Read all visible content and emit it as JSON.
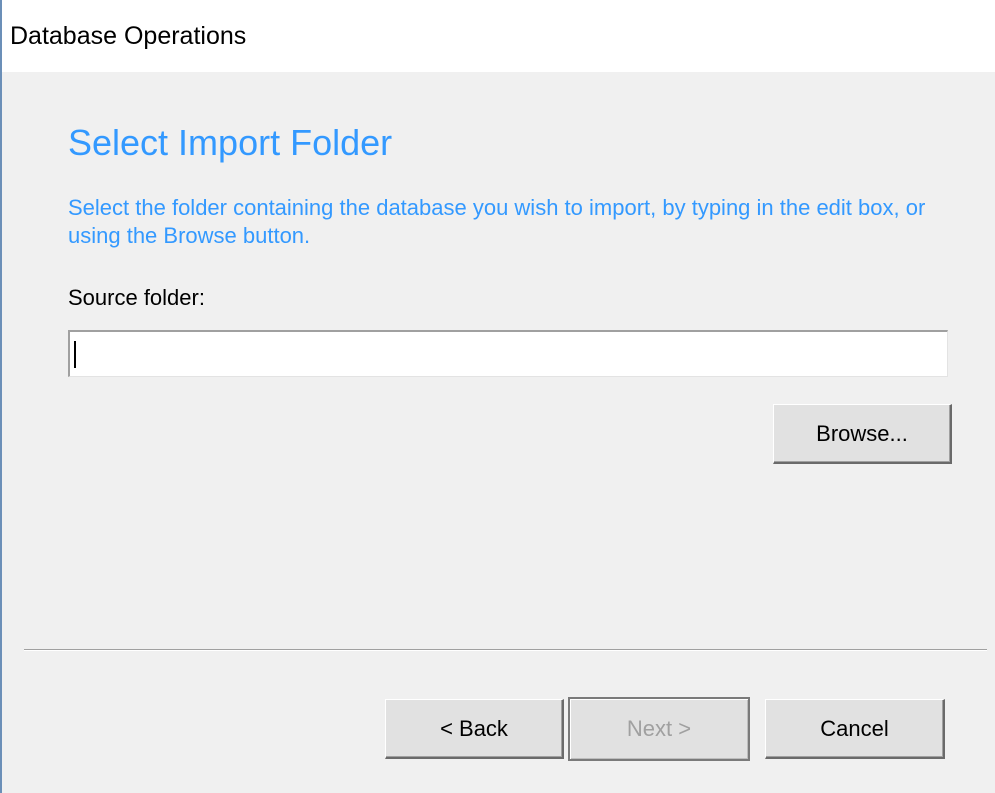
{
  "window": {
    "title": "Database Operations"
  },
  "page": {
    "heading": "Select Import Folder",
    "description": "Select the folder containing the database you wish to import, by typing in the edit box, or using the Browse button."
  },
  "source_folder": {
    "label": "Source folder:",
    "value": ""
  },
  "buttons": {
    "browse": {
      "label": "Browse...",
      "enabled": true
    },
    "back": {
      "label": "< Back",
      "enabled": true
    },
    "next": {
      "label": "Next >",
      "enabled": false
    },
    "cancel": {
      "label": "Cancel",
      "enabled": true
    }
  },
  "colors": {
    "accent": "#3399ff",
    "background": "#f0f0f0",
    "titlebar": "#ffffff",
    "disabled_text": "#a0a0a0"
  }
}
